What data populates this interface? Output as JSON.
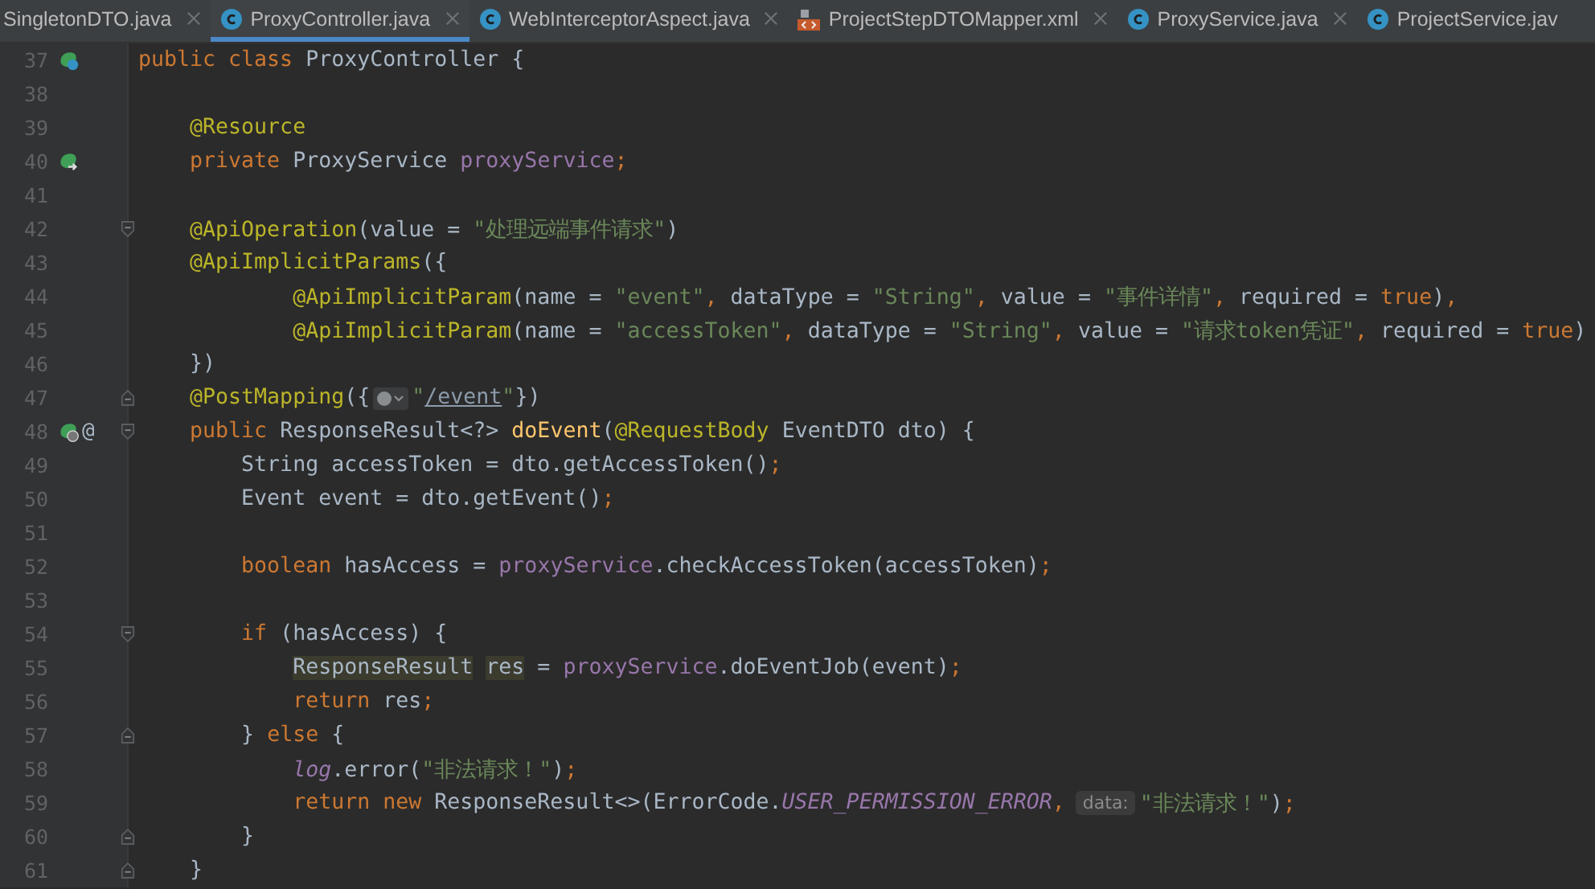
{
  "tabs": [
    {
      "label": "SingletonDTO.java",
      "kind": "plain",
      "selected": false,
      "closable": true
    },
    {
      "label": "ProxyController.java",
      "kind": "class",
      "selected": true,
      "closable": true
    },
    {
      "label": "WebInterceptorAspect.java",
      "kind": "class",
      "selected": false,
      "closable": true
    },
    {
      "label": "ProjectStepDTOMapper.xml",
      "kind": "xml",
      "selected": false,
      "closable": true
    },
    {
      "label": "ProxyService.java",
      "kind": "class",
      "selected": false,
      "closable": true
    },
    {
      "label": "ProjectService.jav",
      "kind": "class",
      "selected": false,
      "closable": false
    }
  ],
  "lines": [
    {
      "number": "37",
      "gutter_icons": [
        {
          "kind": "bean-class"
        }
      ],
      "segments": [
        {
          "kind": "code",
          "tokens": [
            {
              "kind": "kw",
              "text": "public class "
            },
            {
              "kind": "plain",
              "text": "ProxyController {"
            }
          ]
        }
      ]
    },
    {
      "number": "38"
    },
    {
      "number": "39",
      "segments": [
        {
          "kind": "code",
          "tokens": [
            {
              "kind": "ann",
              "text": "    @Resource"
            }
          ]
        }
      ]
    },
    {
      "number": "40",
      "gutter_icons": [
        {
          "kind": "bean-arrow"
        }
      ],
      "segments": [
        {
          "kind": "code",
          "tokens": [
            {
              "kind": "kw",
              "text": "    private "
            },
            {
              "kind": "plain",
              "text": "ProxyService "
            },
            {
              "kind": "field",
              "text": "proxyService"
            },
            {
              "kind": "kw",
              "text": ";"
            }
          ]
        }
      ]
    },
    {
      "number": "41"
    },
    {
      "number": "42",
      "fold": {
        "kind": "start"
      },
      "segments": [
        {
          "kind": "code",
          "tokens": [
            {
              "kind": "ann",
              "text": "    @ApiOperation"
            },
            {
              "kind": "plain",
              "text": "(value = "
            },
            {
              "kind": "str",
              "text": "\"处理远端事件请求\""
            },
            {
              "kind": "plain",
              "text": ")"
            }
          ]
        }
      ]
    },
    {
      "number": "43",
      "segments": [
        {
          "kind": "code",
          "tokens": [
            {
              "kind": "ann",
              "text": "    @ApiImplicitParams"
            },
            {
              "kind": "plain",
              "text": "({"
            }
          ]
        }
      ]
    },
    {
      "number": "44",
      "segments": [
        {
          "kind": "code",
          "tokens": [
            {
              "kind": "ann",
              "text": "            @ApiImplicitParam"
            },
            {
              "kind": "plain",
              "text": "(name = "
            },
            {
              "kind": "str",
              "text": "\"event\""
            },
            {
              "kind": "kw",
              "text": ", "
            },
            {
              "kind": "plain",
              "text": "dataType = "
            },
            {
              "kind": "str",
              "text": "\"String\""
            },
            {
              "kind": "kw",
              "text": ", "
            },
            {
              "kind": "plain",
              "text": "value = "
            },
            {
              "kind": "str",
              "text": "\"事件详情\""
            },
            {
              "kind": "kw",
              "text": ", "
            },
            {
              "kind": "plain",
              "text": "required = "
            },
            {
              "kind": "kw",
              "text": "true"
            },
            {
              "kind": "plain",
              "text": ")"
            },
            {
              "kind": "kw",
              "text": ","
            }
          ]
        }
      ]
    },
    {
      "number": "45",
      "segments": [
        {
          "kind": "code",
          "tokens": [
            {
              "kind": "ann",
              "text": "            @ApiImplicitParam"
            },
            {
              "kind": "plain",
              "text": "(name = "
            },
            {
              "kind": "str",
              "text": "\"accessToken\""
            },
            {
              "kind": "kw",
              "text": ", "
            },
            {
              "kind": "plain",
              "text": "dataType = "
            },
            {
              "kind": "str",
              "text": "\"String\""
            },
            {
              "kind": "kw",
              "text": ", "
            },
            {
              "kind": "plain",
              "text": "value = "
            },
            {
              "kind": "str",
              "text": "\"请求token凭证\""
            },
            {
              "kind": "kw",
              "text": ", "
            },
            {
              "kind": "plain",
              "text": "required = "
            },
            {
              "kind": "kw",
              "text": "true"
            },
            {
              "kind": "plain",
              "text": ")"
            }
          ]
        }
      ]
    },
    {
      "number": "46",
      "segments": [
        {
          "kind": "code",
          "tokens": [
            {
              "kind": "plain",
              "text": "    })"
            }
          ]
        }
      ]
    },
    {
      "number": "47",
      "fold": {
        "kind": "end"
      },
      "segments": [
        {
          "kind": "code",
          "tokens": [
            {
              "kind": "ann",
              "text": "    @PostMapping"
            },
            {
              "kind": "plain",
              "text": "({"
            }
          ]
        },
        {
          "kind": "globe"
        },
        {
          "kind": "code",
          "tokens": [
            {
              "kind": "str",
              "text": "\""
            },
            {
              "kind": "link",
              "text": "/event"
            },
            {
              "kind": "str",
              "text": "\""
            },
            {
              "kind": "plain",
              "text": "})"
            }
          ]
        }
      ]
    },
    {
      "number": "48",
      "gutter_icons": [
        {
          "kind": "bean-globe"
        }
      ],
      "gutter_text": "@",
      "fold": {
        "kind": "start"
      },
      "segments": [
        {
          "kind": "code",
          "tokens": [
            {
              "kind": "kw",
              "text": "    public "
            },
            {
              "kind": "plain",
              "text": "ResponseResult<?> "
            },
            {
              "kind": "method",
              "text": "doEvent"
            },
            {
              "kind": "plain",
              "text": "("
            },
            {
              "kind": "ann",
              "text": "@RequestBody "
            },
            {
              "kind": "plain",
              "text": "EventDTO dto) {"
            }
          ]
        }
      ]
    },
    {
      "number": "49",
      "segments": [
        {
          "kind": "code",
          "tokens": [
            {
              "kind": "plain",
              "text": "        String accessToken = dto.getAccessToken()"
            },
            {
              "kind": "kw",
              "text": ";"
            }
          ]
        }
      ]
    },
    {
      "number": "50",
      "segments": [
        {
          "kind": "code",
          "tokens": [
            {
              "kind": "plain",
              "text": "        Event event = dto.getEvent()"
            },
            {
              "kind": "kw",
              "text": ";"
            }
          ]
        }
      ]
    },
    {
      "number": "51"
    },
    {
      "number": "52",
      "segments": [
        {
          "kind": "code",
          "tokens": [
            {
              "kind": "kw",
              "text": "        boolean "
            },
            {
              "kind": "plain",
              "text": "hasAccess = "
            },
            {
              "kind": "field",
              "text": "proxyService"
            },
            {
              "kind": "plain",
              "text": ".checkAccessToken(accessToken)"
            },
            {
              "kind": "kw",
              "text": ";"
            }
          ]
        }
      ]
    },
    {
      "number": "53"
    },
    {
      "number": "54",
      "fold": {
        "kind": "start"
      },
      "segments": [
        {
          "kind": "code",
          "tokens": [
            {
              "kind": "kw",
              "text": "        if "
            },
            {
              "kind": "plain",
              "text": "(hasAccess) {"
            }
          ]
        }
      ]
    },
    {
      "number": "55",
      "segments": [
        {
          "kind": "code",
          "tokens": [
            {
              "kind": "hl",
              "text": "ResponseResult"
            },
            {
              "kind": "hl",
              "text": "res"
            },
            {
              "kind": "plain",
              "text": " = "
            },
            {
              "kind": "field",
              "text": "proxyService"
            },
            {
              "kind": "plain",
              "text": ".doEventJob(event)"
            },
            {
              "kind": "kw",
              "text": ";"
            }
          ]
        }
      ]
    },
    {
      "number": "56",
      "segments": [
        {
          "kind": "code",
          "tokens": [
            {
              "kind": "kw",
              "text": "            return "
            },
            {
              "kind": "plain",
              "text": "res"
            },
            {
              "kind": "kw",
              "text": ";"
            }
          ]
        }
      ]
    },
    {
      "number": "57",
      "fold": {
        "kind": "end"
      },
      "segments": [
        {
          "kind": "code",
          "tokens": [
            {
              "kind": "plain",
              "text": "        } "
            },
            {
              "kind": "kw",
              "text": "else "
            },
            {
              "kind": "plain",
              "text": "{"
            }
          ]
        }
      ]
    },
    {
      "number": "58",
      "segments": [
        {
          "kind": "code",
          "tokens": [
            {
              "kind": "static",
              "text": "            log"
            },
            {
              "kind": "plain",
              "text": ".error("
            },
            {
              "kind": "str",
              "text": "\"非法请求！\""
            },
            {
              "kind": "plain",
              "text": ")"
            },
            {
              "kind": "kw",
              "text": ";"
            }
          ]
        }
      ]
    },
    {
      "number": "59",
      "segments": [
        {
          "kind": "code",
          "tokens": [
            {
              "kind": "kw",
              "text": "            return new "
            },
            {
              "kind": "plain",
              "text": "ResponseResult<>(ErrorCode."
            },
            {
              "kind": "static",
              "text": "USER_PERMISSION_ERROR"
            },
            {
              "kind": "kw",
              "text": ","
            }
          ]
        },
        {
          "kind": "hint",
          "text": "data:"
        },
        {
          "kind": "code",
          "tokens": [
            {
              "kind": "str",
              "text": "\"非法请求！\""
            },
            {
              "kind": "plain",
              "text": ")"
            },
            {
              "kind": "kw",
              "text": ";"
            }
          ]
        }
      ]
    },
    {
      "number": "60",
      "fold": {
        "kind": "end"
      },
      "segments": [
        {
          "kind": "code",
          "tokens": [
            {
              "kind": "plain",
              "text": "        }"
            }
          ]
        }
      ]
    },
    {
      "number": "61",
      "fold": {
        "kind": "end"
      },
      "segments": [
        {
          "kind": "code",
          "tokens": [
            {
              "kind": "plain",
              "text": "    }"
            }
          ]
        }
      ]
    }
  ]
}
